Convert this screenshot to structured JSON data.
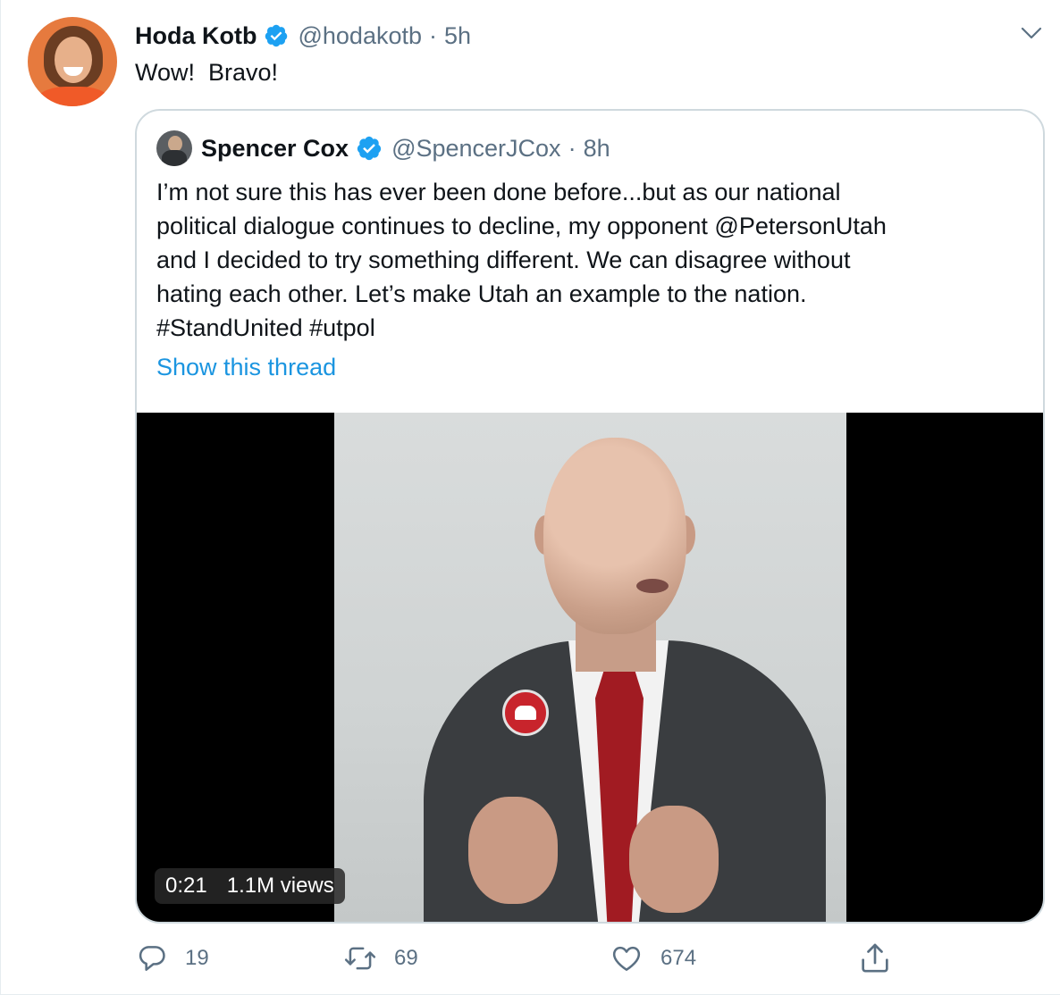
{
  "tweet": {
    "display_name": "Hoda Kotb",
    "handle": "@hodakotb",
    "separator": "·",
    "time": "5h",
    "text": "Wow!  Bravo!",
    "accent_color": "#1b95e0"
  },
  "quote": {
    "display_name": "Spencer Cox",
    "handle": "@SpencerJCox",
    "separator": "·",
    "time": "8h",
    "lines": [
      "I’m not sure this has ever been done before...but as our national",
      "political dialogue continues to decline, my opponent @PetersonUtah",
      "and I decided to try something different. We can disagree without",
      "hating each other. Let’s make Utah an example to the nation.",
      "#StandUnited #utpol"
    ],
    "show_thread": "Show this thread",
    "video": {
      "duration": "0:21",
      "views": "1.1M views"
    }
  },
  "actions": {
    "replies": "19",
    "retweets": "69",
    "likes": "674"
  },
  "icons": {
    "verified": "verified-badge-icon",
    "more": "chevron-down-icon",
    "reply": "reply-icon",
    "retweet": "retweet-icon",
    "like": "heart-icon",
    "share": "share-icon"
  }
}
